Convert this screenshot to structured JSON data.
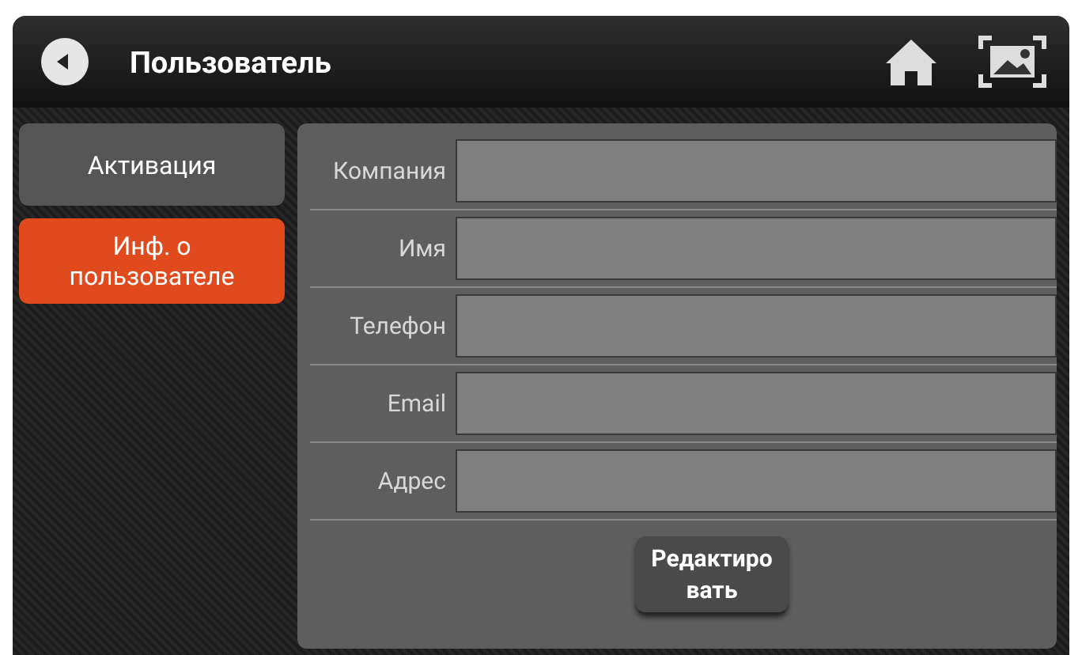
{
  "header": {
    "title": "Пользователь"
  },
  "tabs": [
    {
      "label": "Активация",
      "selected": false
    },
    {
      "label": "Инф. о пользователе",
      "selected": true
    }
  ],
  "form": {
    "fields": [
      {
        "label": "Компания"
      },
      {
        "label": "Имя"
      },
      {
        "label": "Телефон"
      },
      {
        "label": "Email"
      },
      {
        "label": "Адрес"
      }
    ],
    "edit_button": "Редактиро\nвать"
  }
}
